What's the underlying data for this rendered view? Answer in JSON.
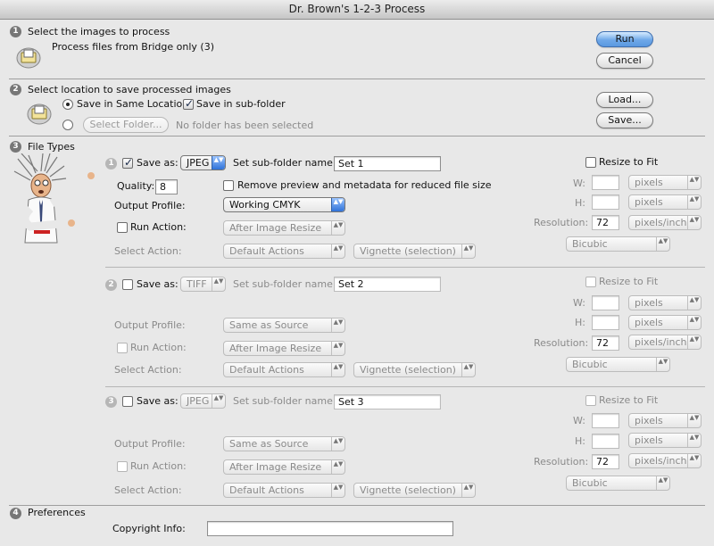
{
  "window": {
    "title": "Dr. Brown's 1-2-3 Process"
  },
  "buttons": {
    "run": "Run",
    "cancel": "Cancel",
    "load": "Load...",
    "save": "Save..."
  },
  "sec1": {
    "num": "1",
    "title": "Select the images to process",
    "text": "Process files from Bridge only (3)"
  },
  "sec2": {
    "num": "2",
    "title": "Select location to save processed images",
    "same_location": "Save in Same Location",
    "sub_folder": "Save in sub-folder",
    "select_folder": "Select Folder...",
    "no_folder": "No folder has been selected"
  },
  "sec3": {
    "num": "3",
    "title": "File Types"
  },
  "sec4": {
    "num": "4",
    "title": "Preferences",
    "copyright_label": "Copyright Info:",
    "copyright_value": ""
  },
  "labels": {
    "save_as": "Save as:",
    "sub_folder_name": "Set sub-folder name:",
    "quality": "Quality:",
    "remove_preview": "Remove preview and metadata for reduced file size",
    "output_profile": "Output Profile:",
    "run_action": "Run Action:",
    "select_action": "Select Action:",
    "resize_to_fit": "Resize to Fit",
    "w": "W:",
    "h": "H:",
    "resolution": "Resolution:"
  },
  "sets": [
    {
      "num": "1",
      "format": "JPEG",
      "folder": "Set 1",
      "quality": "8",
      "profile": "Working CMYK",
      "after": "After Image Resize",
      "actions": "Default Actions",
      "action": "Vignette (selection)",
      "unit": "pixels",
      "res": "72",
      "res_unit": "pixels/inch",
      "interp": "Bicubic"
    },
    {
      "num": "2",
      "format": "TIFF",
      "folder": "Set 2",
      "profile": "Same as Source",
      "after": "After Image Resize",
      "actions": "Default Actions",
      "action": "Vignette (selection)",
      "unit": "pixels",
      "res": "72",
      "res_unit": "pixels/inch",
      "interp": "Bicubic"
    },
    {
      "num": "3",
      "format": "JPEG",
      "folder": "Set 3",
      "profile": "Same as Source",
      "after": "After Image Resize",
      "actions": "Default Actions",
      "action": "Vignette (selection)",
      "unit": "pixels",
      "res": "72",
      "res_unit": "pixels/inch",
      "interp": "Bicubic"
    }
  ],
  "arrows": "▲▼"
}
